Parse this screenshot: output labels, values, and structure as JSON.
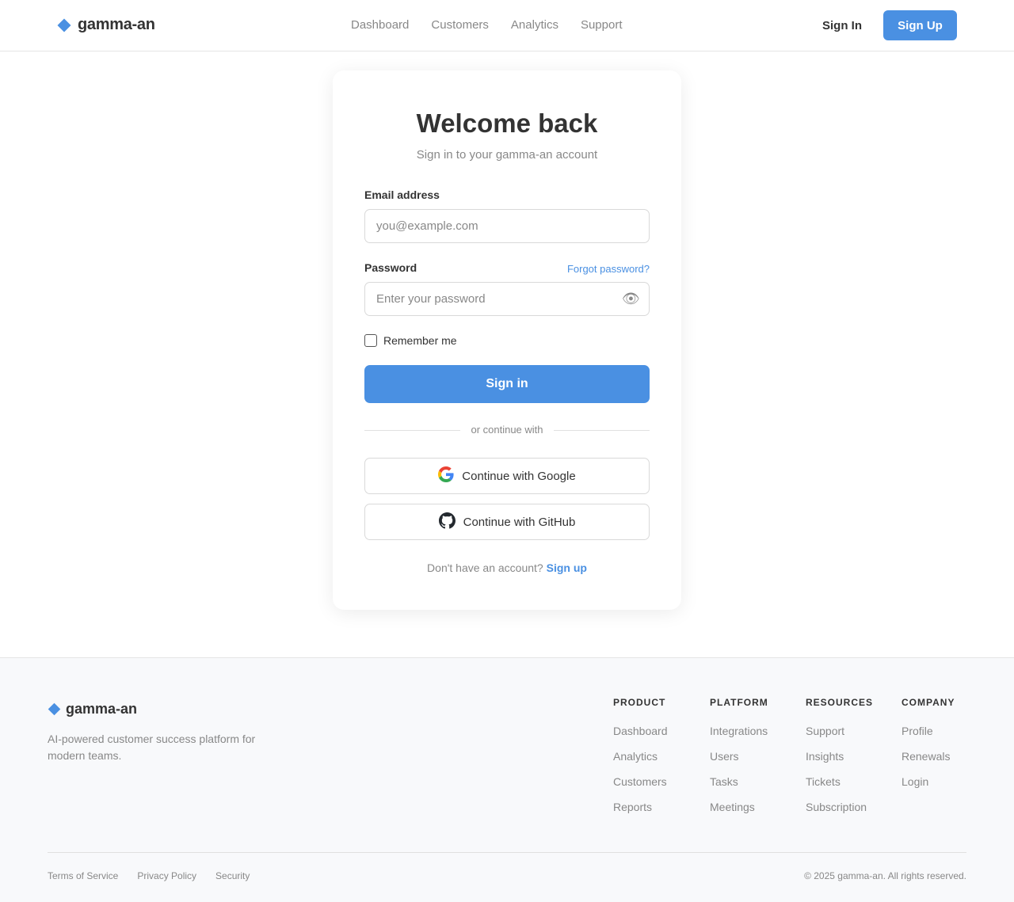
{
  "brand": {
    "name": "gamma-an",
    "accent_color": "#4a90e2"
  },
  "header": {
    "nav": [
      "Dashboard",
      "Customers",
      "Analytics",
      "Support"
    ],
    "signin_label": "Sign In",
    "signup_label": "Sign Up"
  },
  "card": {
    "title": "Welcome back",
    "subtitle": "Sign in to your gamma-an account",
    "email_label": "Email address",
    "email_placeholder": "you@example.com",
    "password_label": "Password",
    "forgot_label": "Forgot password?",
    "password_placeholder": "Enter your password",
    "eye_icon": "👁",
    "remember_label": "Remember me",
    "submit_label": "Sign in",
    "divider_text": "or continue with",
    "google_label": "Continue with Google",
    "github_label": "Continue with GitHub",
    "no_account_text": "Don't have an account?",
    "signup_link": "Sign up"
  },
  "footer": {
    "tagline": "AI-powered customer success platform for modern teams.",
    "columns": [
      {
        "heading": "PRODUCT",
        "items": [
          "Dashboard",
          "Analytics",
          "Customers",
          "Reports"
        ]
      },
      {
        "heading": "PLATFORM",
        "items": [
          "Integrations",
          "Users",
          "Tasks",
          "Meetings"
        ]
      },
      {
        "heading": "RESOURCES",
        "items": [
          "Support",
          "Insights",
          "Tickets",
          "Subscription"
        ]
      },
      {
        "heading": "COMPANY",
        "items": [
          "Profile",
          "Renewals",
          "Login"
        ]
      }
    ],
    "legal": [
      "Terms of Service",
      "Privacy Policy",
      "Security"
    ],
    "copyright": "© 2025 gamma-an. All rights reserved."
  }
}
